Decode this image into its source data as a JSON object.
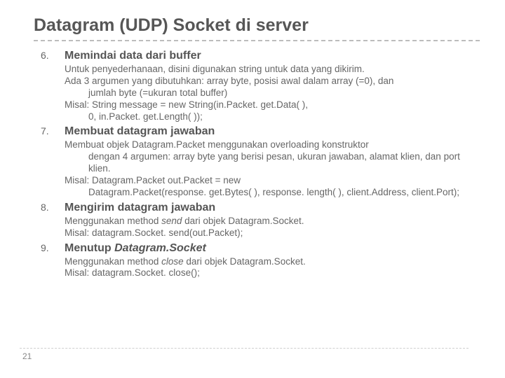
{
  "title": "Datagram (UDP) Socket di server",
  "items": [
    {
      "num": "6.",
      "heading": "Memindai data dari buffer",
      "body_html": "Untuk penyederhanaan, disini digunakan string untuk data yang dikirim.<br>Ada 3 argumen yang dibutuhkan: array byte, posisi awal dalam array (=0), dan<span class=\"indent\">jumlah byte (=ukuran total buffer)</span>Misal: String message = new String(in.Packet. get.Data( ),<span class=\"indent\">0, in.Packet. get.Length( ));</span>"
    },
    {
      "num": "7.",
      "heading": "Membuat datagram jawaban",
      "body_html": "Membuat objek Datagram.Packet menggunakan overloading konstruktor<span class=\"indent\">dengan 4 argumen: array byte yang berisi pesan, ukuran jawaban, alamat klien, dan port klien.</span>Misal: Datagram.Packet out.Packet = new<span class=\"indent\">Datagram.Packet(response. get.Bytes( ), response. length( ), client.Address, client.Port);</span>"
    },
    {
      "num": "8.",
      "heading": "Mengirim datagram jawaban",
      "body_html": "Menggunakan method <span class=\"italic\">send</span> dari objek Datagram.Socket.<br>Misal: datagram.Socket. send(out.Packet);"
    },
    {
      "num": "9.",
      "heading_html": "Menutup <span class=\"italic\">Datagram.Socket</span>",
      "body_html": "Menggunakan method <span class=\"italic\">close</span> dari objek Datagram.Socket.<br>Misal: datagram.Socket. close();"
    }
  ],
  "page_number": "21"
}
